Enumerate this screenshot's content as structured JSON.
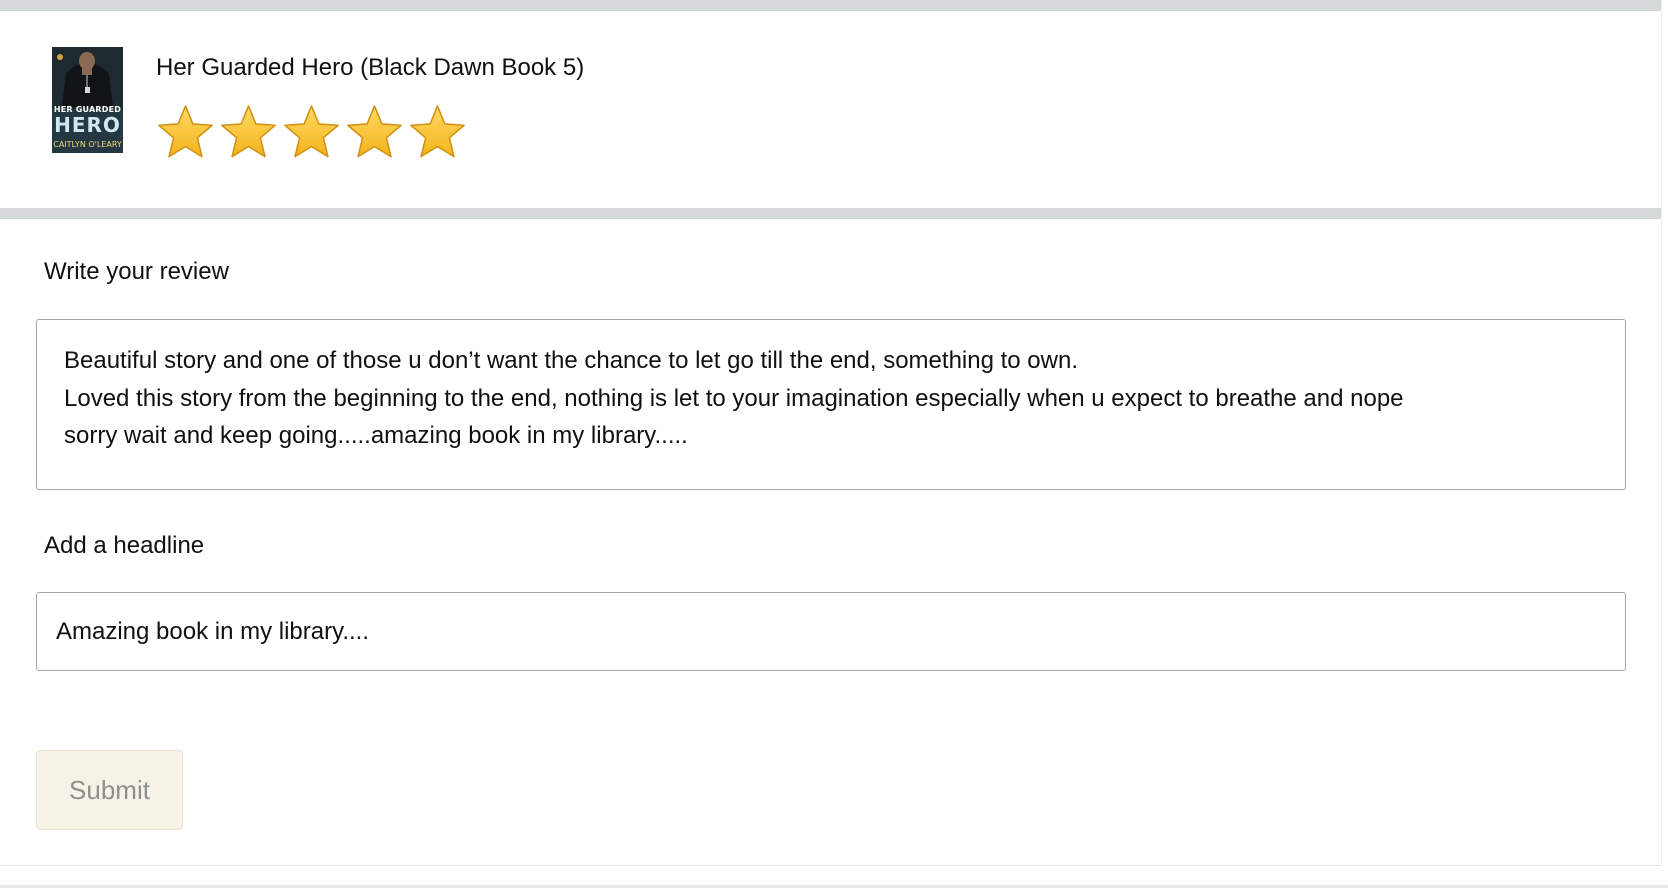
{
  "product": {
    "title": "Her Guarded Hero (Black Dawn Book 5)",
    "cover": {
      "title_small": "HER GUARDED",
      "title_large": "HERO",
      "author": "CAITLYN O'LEARY"
    },
    "rating": {
      "value": 5,
      "max": 5,
      "star_color": "#f4b41a"
    }
  },
  "review": {
    "label": "Write your review",
    "lines": [
      "Beautiful story and one of those u don’t want the chance to let go till the end, something to own.",
      "Loved this story from the beginning to the end, nothing is let to your imagination especially when u expect to breathe and nope",
      "sorry wait and keep going.....amazing book in my library....."
    ]
  },
  "headline": {
    "label": "Add a headline",
    "value": "Amazing book in my library...."
  },
  "submit": {
    "label": "Submit"
  },
  "colors": {
    "divider": "#d5d9d9",
    "submit_bg": "#f7f2e6",
    "submit_text": "#8f8f8f"
  }
}
